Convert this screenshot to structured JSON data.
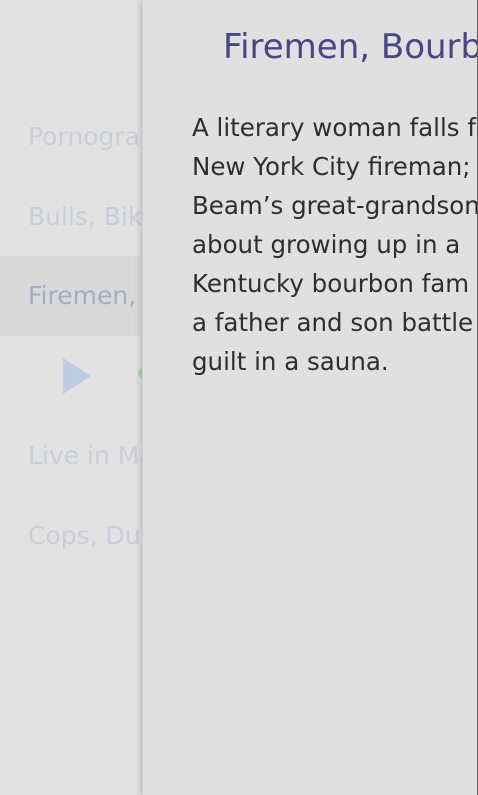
{
  "episode_list": {
    "rows": [
      {
        "label": "Pornogra"
      },
      {
        "label": "Bulls, Bik"
      },
      {
        "label": "Firemen,"
      },
      {
        "label": "Live in Ma"
      },
      {
        "label": "Cops, Du"
      }
    ]
  },
  "detail_panel": {
    "title": "Firemen, Bourb",
    "description_lines": [
      "A literary woman falls f",
      "New York City fireman;",
      "Beam’s great-grandson",
      "about growing up in a",
      "Kentucky bourbon fam",
      "a father and son battle",
      "guilt in a sauna."
    ]
  },
  "colors": {
    "panel_background": "#e0e0e0",
    "title_color": "#4a4587",
    "play_icon_color": "#bccde2",
    "status_dot_color": "#b5d6a6"
  }
}
